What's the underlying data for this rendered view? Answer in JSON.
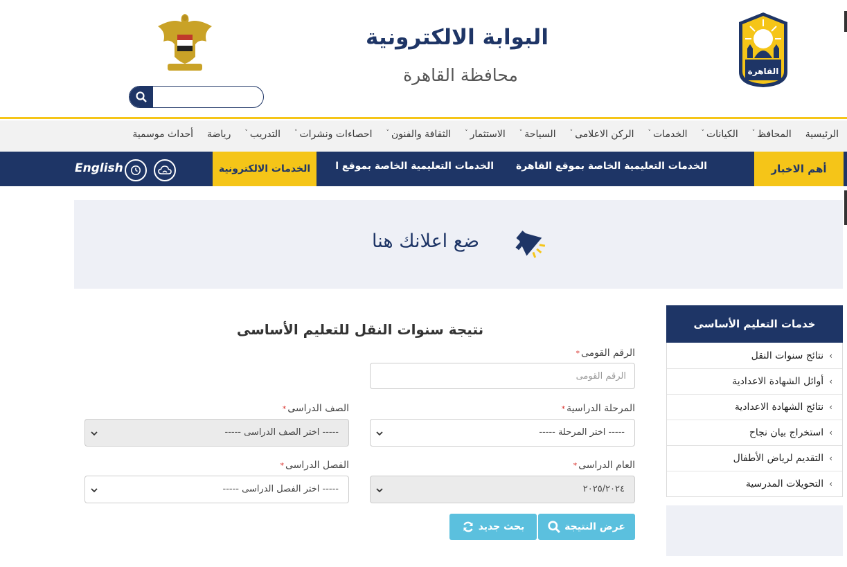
{
  "header": {
    "title": "البوابة الالكترونية",
    "subtitle": "محافظة القاهرة",
    "search": {
      "value": "",
      "placeholder": ""
    },
    "cairo_logo_text": "القاهرة"
  },
  "nav": {
    "items": [
      {
        "label": "الرئيسية",
        "dropdown": false
      },
      {
        "label": "المحافظ",
        "dropdown": true
      },
      {
        "label": "الكيانات",
        "dropdown": true
      },
      {
        "label": "الخدمات",
        "dropdown": true
      },
      {
        "label": "الركن الاعلامى",
        "dropdown": true
      },
      {
        "label": "السياحة",
        "dropdown": true
      },
      {
        "label": "الاستثمار",
        "dropdown": true
      },
      {
        "label": "الثقافة والفنون",
        "dropdown": true
      },
      {
        "label": "احصاءات ونشرات",
        "dropdown": true
      },
      {
        "label": "التدريب",
        "dropdown": true
      },
      {
        "label": "رياضة",
        "dropdown": false
      },
      {
        "label": "أحداث موسمية",
        "dropdown": false
      }
    ]
  },
  "newsbar": {
    "label": "أهم الاخبار",
    "ticker": [
      "الخدمات التعليمية الخاصة بموقع القاهرة",
      "الخدمات التعليمية الخاصة بموقع ا"
    ],
    "eservices_label": "الخدمات الالكترونية",
    "english_label": "English"
  },
  "ad": {
    "text": "ضع اعلانك هنا"
  },
  "sidebar": {
    "title": "خدمات التعليم الأساسى",
    "items": [
      "نتائج سنوات النقل",
      "أوائل الشهادة الاعدادية",
      "نتائج الشهادة الاعدادية",
      "استخراج بيان نجاح",
      "التقديم لرياض الأطفال",
      "التحويلات المدرسية"
    ]
  },
  "form": {
    "title": "نتيجة سنوات النقل للتعليم الأساسى",
    "national_id": {
      "label": "الرقم القومى",
      "placeholder": "الرقم القومى",
      "value": ""
    },
    "stage": {
      "label": "المرحلة الدراسية",
      "selected": "----- اختر المرحلة -----"
    },
    "grade": {
      "label": "الصف الدراسى",
      "selected": "----- اختر الصف الدراسى -----"
    },
    "year": {
      "label": "العام الدراسى",
      "selected": "٢٠٢٥/٢٠٢٤"
    },
    "term": {
      "label": "الفصل الدراسى",
      "selected": "----- اختر الفصل الدراسى -----"
    },
    "show_result_label": "عرض النتيجة",
    "new_search_label": "بحث جديد"
  },
  "colors": {
    "primary": "#1e3566",
    "accent": "#f5c518",
    "button": "#5bc0de",
    "banner_bg": "#eef0f6"
  }
}
